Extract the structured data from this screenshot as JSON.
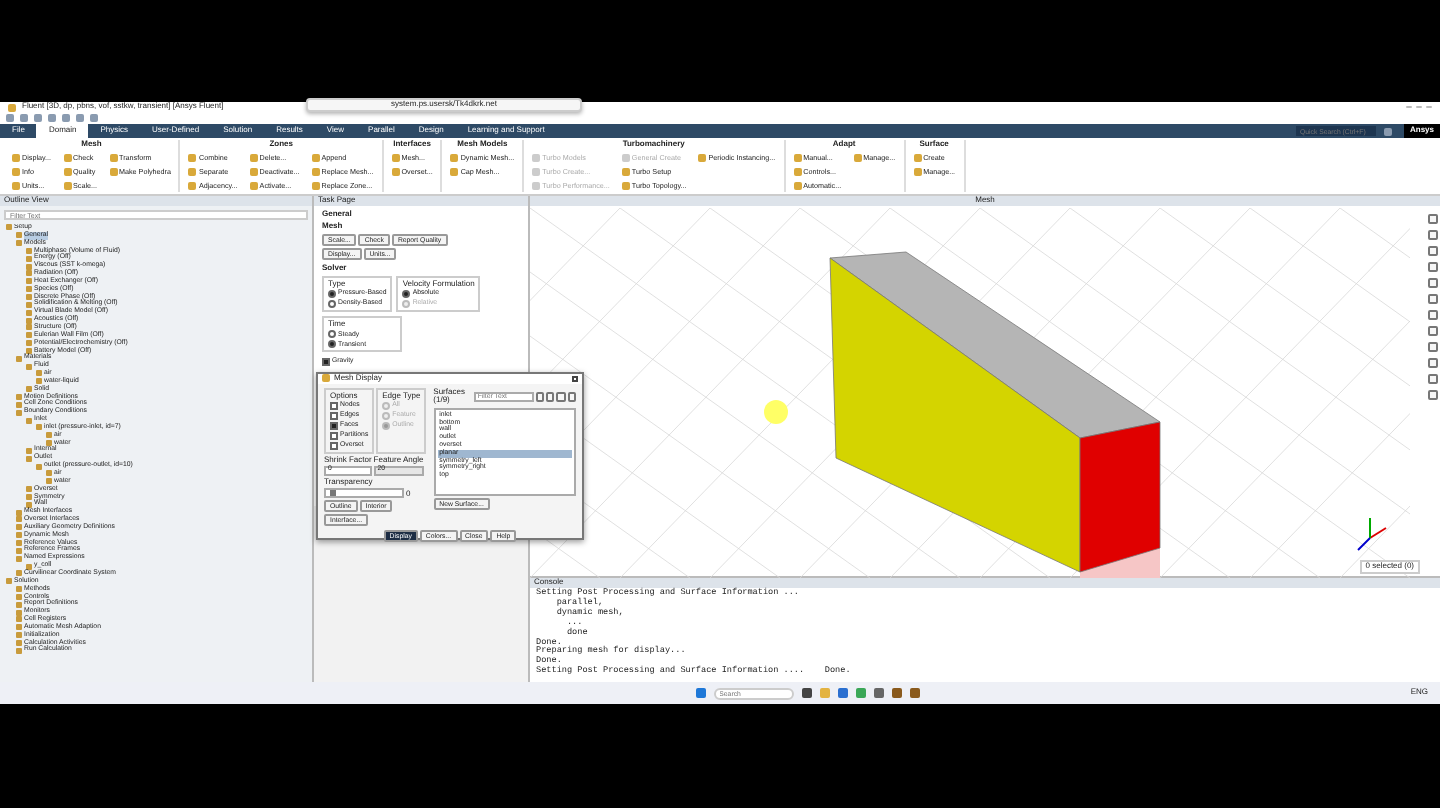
{
  "window": {
    "title": "Fluent [3D, dp, pbns, vof, sstkw, transient] [Ansys Fluent]"
  },
  "share_bar": {
    "text": "system.ps.usersk/Tk4dkrk.net"
  },
  "tabs": [
    {
      "label": "File",
      "selected": false
    },
    {
      "label": "Domain",
      "selected": true
    },
    {
      "label": "Physics",
      "selected": false
    },
    {
      "label": "User-Defined",
      "selected": false
    },
    {
      "label": "Solution",
      "selected": false
    },
    {
      "label": "Results",
      "selected": false
    },
    {
      "label": "View",
      "selected": false
    },
    {
      "label": "Parallel",
      "selected": false
    },
    {
      "label": "Design",
      "selected": false
    },
    {
      "label": "Learning and Support",
      "selected": false
    }
  ],
  "quick_search": {
    "placeholder": "Quick Search (Ctrl+F)"
  },
  "logo": "Ansys",
  "ribbon": [
    {
      "title": "Mesh",
      "buttons": [
        {
          "label": "Display...",
          "disabled": false
        },
        {
          "label": "Info",
          "disabled": false
        },
        {
          "label": "Units...",
          "disabled": false
        },
        {
          "label": "Check",
          "disabled": false
        },
        {
          "label": "Quality",
          "disabled": false
        },
        {
          "label": "Scale...",
          "disabled": false
        },
        {
          "label": "Transform",
          "disabled": false
        },
        {
          "label": "Make Polyhedra",
          "disabled": false
        }
      ]
    },
    {
      "title": "Zones",
      "buttons": [
        {
          "label": "Combine",
          "disabled": false
        },
        {
          "label": "Separate",
          "disabled": false
        },
        {
          "label": "Adjacency...",
          "disabled": false
        },
        {
          "label": "Delete...",
          "disabled": false
        },
        {
          "label": "Deactivate...",
          "disabled": false
        },
        {
          "label": "Activate...",
          "disabled": false
        },
        {
          "label": "Append",
          "disabled": false
        },
        {
          "label": "Replace Mesh...",
          "disabled": false
        },
        {
          "label": "Replace Zone...",
          "disabled": false
        }
      ]
    },
    {
      "title": "Interfaces",
      "buttons": [
        {
          "label": "Mesh...",
          "disabled": false
        },
        {
          "label": "Overset...",
          "disabled": false
        }
      ]
    },
    {
      "title": "Mesh Models",
      "buttons": [
        {
          "label": "Dynamic Mesh...",
          "disabled": false
        },
        {
          "label": "Cap Mesh...",
          "disabled": false
        }
      ]
    },
    {
      "title": "Turbomachinery",
      "buttons": [
        {
          "label": "Turbo Models",
          "disabled": true
        },
        {
          "label": "Turbo Create...",
          "disabled": true
        },
        {
          "label": "Turbo Performance...",
          "disabled": true
        },
        {
          "label": "General Create",
          "disabled": true
        },
        {
          "label": "Turbo Setup",
          "disabled": false
        },
        {
          "label": "Turbo Topology...",
          "disabled": false
        },
        {
          "label": "Periodic Instancing...",
          "disabled": false
        }
      ]
    },
    {
      "title": "Adapt",
      "buttons": [
        {
          "label": "Manual...",
          "disabled": false
        },
        {
          "label": "Controls...",
          "disabled": false
        },
        {
          "label": "Automatic...",
          "disabled": false
        },
        {
          "label": "Manage...",
          "disabled": false
        }
      ]
    },
    {
      "title": "Surface",
      "buttons": [
        {
          "label": "Create",
          "disabled": false
        },
        {
          "label": "Manage...",
          "disabled": false
        }
      ]
    }
  ],
  "outline": {
    "title": "Outline View",
    "filter_placeholder": "Filter Text",
    "tree": [
      {
        "label": "Setup",
        "selected": false,
        "children": [
          {
            "label": "General",
            "selected": true
          },
          {
            "label": "Models",
            "selected": false,
            "children": [
              {
                "label": "Multiphase (Volume of Fluid)",
                "selected": false
              },
              {
                "label": "Energy (Off)",
                "selected": false
              },
              {
                "label": "Viscous (SST k-omega)",
                "selected": false
              },
              {
                "label": "Radiation (Off)",
                "selected": false
              },
              {
                "label": "Heat Exchanger (Off)",
                "selected": false
              },
              {
                "label": "Species (Off)",
                "selected": false
              },
              {
                "label": "Discrete Phase (Off)",
                "selected": false
              },
              {
                "label": "Solidification & Melting (Off)",
                "selected": false
              },
              {
                "label": "Virtual Blade Model (Off)",
                "selected": false
              },
              {
                "label": "Acoustics (Off)",
                "selected": false
              },
              {
                "label": "Structure (Off)",
                "selected": false
              },
              {
                "label": "Eulerian Wall Film (Off)",
                "selected": false
              },
              {
                "label": "Potential/Electrochemistry (Off)",
                "selected": false
              },
              {
                "label": "Battery Model (Off)",
                "selected": false
              }
            ]
          },
          {
            "label": "Materials",
            "selected": false,
            "children": [
              {
                "label": "Fluid",
                "selected": false,
                "children": [
                  {
                    "label": "air",
                    "selected": false
                  },
                  {
                    "label": "water-liquid",
                    "selected": false
                  }
                ]
              },
              {
                "label": "Solid",
                "selected": false
              }
            ]
          },
          {
            "label": "Motion Definitions",
            "selected": false
          },
          {
            "label": "Cell Zone Conditions",
            "selected": false
          },
          {
            "label": "Boundary Conditions",
            "selected": false,
            "children": [
              {
                "label": "Inlet",
                "selected": false,
                "children": [
                  {
                    "label": "inlet (pressure-inlet, id=7)",
                    "selected": false,
                    "children": [
                      {
                        "label": "air",
                        "selected": false
                      },
                      {
                        "label": "water",
                        "selected": false
                      }
                    ]
                  }
                ]
              },
              {
                "label": "Internal",
                "selected": false
              },
              {
                "label": "Outlet",
                "selected": false,
                "children": [
                  {
                    "label": "outlet (pressure-outlet, id=10)",
                    "selected": false,
                    "children": [
                      {
                        "label": "air",
                        "selected": false
                      },
                      {
                        "label": "water",
                        "selected": false
                      }
                    ]
                  }
                ]
              },
              {
                "label": "Overset",
                "selected": false
              },
              {
                "label": "Symmetry",
                "selected": false
              },
              {
                "label": "Wall",
                "selected": false
              }
            ]
          },
          {
            "label": "Mesh Interfaces",
            "selected": false
          },
          {
            "label": "Overset Interfaces",
            "selected": false
          },
          {
            "label": "Auxiliary Geometry Definitions",
            "selected": false
          },
          {
            "label": "Dynamic Mesh",
            "selected": false
          },
          {
            "label": "Reference Values",
            "selected": false
          },
          {
            "label": "Reference Frames",
            "selected": false
          },
          {
            "label": "Named Expressions",
            "selected": false,
            "children": [
              {
                "label": "y_coll",
                "selected": false
              }
            ]
          },
          {
            "label": "Curvilinear Coordinate System",
            "selected": false
          }
        ]
      },
      {
        "label": "Solution",
        "selected": false,
        "children": [
          {
            "label": "Methods",
            "selected": false
          },
          {
            "label": "Controls",
            "selected": false
          },
          {
            "label": "Report Definitions",
            "selected": false
          },
          {
            "label": "Monitors",
            "selected": false
          },
          {
            "label": "Cell Registers",
            "selected": false
          },
          {
            "label": "Automatic Mesh Adaption",
            "selected": false
          },
          {
            "label": "Initialization",
            "selected": false
          },
          {
            "label": "Calculation Activities",
            "selected": false
          },
          {
            "label": "Run Calculation",
            "selected": false
          }
        ]
      }
    ]
  },
  "task_page": {
    "title": "Task Page",
    "heading": "General",
    "mesh_label": "Mesh",
    "mesh_buttons": [
      "Scale...",
      "Check",
      "Report Quality",
      "Display...",
      "Units..."
    ],
    "solver_label": "Solver",
    "type_label": "Type",
    "type_options": [
      {
        "label": "Pressure-Based",
        "selected": true
      },
      {
        "label": "Density-Based",
        "selected": false
      }
    ],
    "velocity_label": "Velocity Formulation",
    "velocity_options": [
      {
        "label": "Absolute",
        "selected": true,
        "disabled": false
      },
      {
        "label": "Relative",
        "selected": false,
        "disabled": true
      }
    ],
    "time_label": "Time",
    "time_options": [
      {
        "label": "Steady",
        "selected": false
      },
      {
        "label": "Transient",
        "selected": true
      }
    ],
    "gravity": {
      "label": "Gravity",
      "checked": true
    }
  },
  "mesh_display": {
    "title": "Mesh Display",
    "options_label": "Options",
    "options": [
      {
        "label": "Nodes",
        "checked": false
      },
      {
        "label": "Edges",
        "checked": false
      },
      {
        "label": "Faces",
        "checked": true
      },
      {
        "label": "Partitions",
        "checked": false
      },
      {
        "label": "Overset",
        "checked": false
      }
    ],
    "edge_type_label": "Edge Type",
    "edge_types": [
      {
        "label": "All",
        "selected": false
      },
      {
        "label": "Feature",
        "selected": false
      },
      {
        "label": "Outline",
        "selected": true
      }
    ],
    "shrink_label": "Shrink Factor",
    "shrink_value": "0",
    "feature_label": "Feature Angle",
    "feature_value": "20",
    "transparency_label": "Transparency",
    "transparency": {
      "level": 0.05,
      "reading": "0"
    },
    "left_buttons": [
      "Outline",
      "Interior",
      "Interface..."
    ],
    "surfaces_label": "Surfaces (1/9)",
    "filter_placeholder": "Filter Text",
    "surfaces": [
      {
        "label": "inlet",
        "selected": false
      },
      {
        "label": "bottom",
        "selected": false
      },
      {
        "label": "wall",
        "selected": false
      },
      {
        "label": "outlet",
        "selected": false
      },
      {
        "label": "overset",
        "selected": false
      },
      {
        "label": "planar",
        "selected": true
      },
      {
        "label": "symmetry_left",
        "selected": false
      },
      {
        "label": "symmetry_right",
        "selected": false
      },
      {
        "label": "top",
        "selected": false
      }
    ],
    "new_surface": "New Surface...",
    "footer": [
      "Display",
      "Colors...",
      "Close",
      "Help"
    ]
  },
  "graphics": {
    "title": "Mesh",
    "selection": "0 selected (0)"
  },
  "console": {
    "title": "Console",
    "lines": [
      "Setting Post Processing and Surface Information ...",
      "    parallel,",
      "    dynamic mesh,",
      "      ...",
      "      done",
      "Done.",
      "Preparing mesh for display...",
      "Done.",
      "Setting Post Processing and Surface Information ....    Done."
    ]
  },
  "taskbar": {
    "placeholder": "Search",
    "tray": "ENG"
  }
}
